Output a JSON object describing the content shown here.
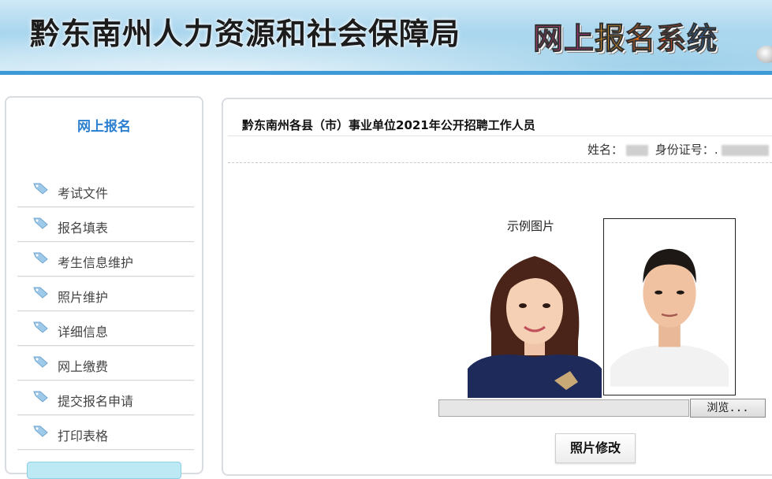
{
  "header": {
    "title": "黔东南州人力资源和社会保障局",
    "system_name": "网上报名系统",
    "system_chars": [
      "网",
      "上",
      "报",
      "名",
      "系",
      "统"
    ]
  },
  "sidebar": {
    "title": "网上报名",
    "items": [
      {
        "label": "考试文件",
        "icon": "tag-icon"
      },
      {
        "label": "报名填表",
        "icon": "tag-icon"
      },
      {
        "label": "考生信息维护",
        "icon": "tag-icon"
      },
      {
        "label": "照片维护",
        "icon": "tag-icon"
      },
      {
        "label": "详细信息",
        "icon": "tag-icon"
      },
      {
        "label": "网上缴费",
        "icon": "tag-icon"
      },
      {
        "label": "提交报名申请",
        "icon": "tag-icon"
      },
      {
        "label": "打印表格",
        "icon": "tag-icon"
      }
    ]
  },
  "main": {
    "title": "黔东南州各县（市）事业单位2021年公开招聘工作人员",
    "user_info": {
      "name_label": "姓名：",
      "id_label": "身份证号：",
      "id_prefix": "."
    },
    "photo": {
      "sample_caption": "示例图片",
      "browse_label": "浏览...",
      "modify_label": "照片修改"
    }
  },
  "colors": {
    "accent": "#2a7fd0",
    "header_line": "#3d9ad6",
    "sidebar_button": "#bde9f5"
  }
}
